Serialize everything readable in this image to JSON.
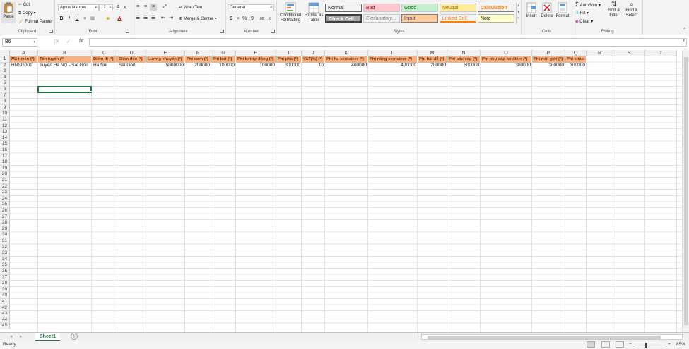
{
  "ribbon": {
    "clipboard": {
      "label": "Clipboard",
      "paste": "Paste",
      "cut": "Cut",
      "copy": "Copy",
      "format_painter": "Format Painter"
    },
    "font": {
      "label": "Font",
      "family": "Aptos Narrow",
      "size": "12"
    },
    "alignment": {
      "label": "Alignment",
      "wrap_text": "Wrap Text",
      "merge_center": "Merge & Center"
    },
    "number": {
      "label": "Number",
      "format": "General"
    },
    "styles": {
      "label": "Styles",
      "conditional": "Conditional Formatting",
      "format_table": "Format as Table",
      "cells": [
        {
          "text": "Normal",
          "bg": "#ffffff",
          "fg": "#000000"
        },
        {
          "text": "Bad",
          "bg": "#ffc7ce",
          "fg": "#9c0006"
        },
        {
          "text": "Good",
          "bg": "#c6efce",
          "fg": "#006100"
        },
        {
          "text": "Neutral",
          "bg": "#ffeb9c",
          "fg": "#9c5700"
        },
        {
          "text": "Calculation",
          "bg": "#f2f2f2",
          "fg": "#fa7d00"
        },
        {
          "text": "Check Cell",
          "bg": "#a5a5a5",
          "fg": "#ffffff"
        },
        {
          "text": "Explanatory...",
          "bg": "#ffffff",
          "fg": "#7f7f7f"
        },
        {
          "text": "Input",
          "bg": "#ffcc99",
          "fg": "#3f3f76"
        },
        {
          "text": "Linked Cell",
          "bg": "#ffffff",
          "fg": "#fa7d00"
        },
        {
          "text": "Note",
          "bg": "#ffffcc",
          "fg": "#000000"
        }
      ]
    },
    "cells": {
      "label": "Cells",
      "insert": "Insert",
      "delete": "Delete",
      "format": "Format"
    },
    "editing": {
      "label": "Editing",
      "autosum": "AutoSum",
      "fill": "Fill",
      "clear": "Clear",
      "sort_filter": "Sort & Filter",
      "find_select": "Find & Select"
    }
  },
  "formula_bar": {
    "name_box": "B6",
    "fx": "fx",
    "content": ""
  },
  "columns": [
    "A",
    "B",
    "C",
    "D",
    "E",
    "F",
    "G",
    "H",
    "I",
    "J",
    "K",
    "L",
    "M",
    "N",
    "O",
    "P",
    "Q",
    "R",
    "S",
    "T"
  ],
  "header_row": [
    "Mã tuyến (*)",
    "Tên tuyến (*)",
    "Điểm đi (*)",
    "Điểm đến (*)",
    "Lương chuyến (*)",
    "Phí cơm (*)",
    "Phí bot (*)",
    "Phí bot tự động (*)",
    "Phí phà (*)",
    "VAT(%) (*)",
    "Phí hạ container (*)",
    "Phí nâng container (*)",
    "Phí bãi đỗ (*)",
    "Phí bốc xếp (*)",
    "Phí phụ cấp bỏ điểm (*)",
    "Phí môi giới (*)",
    "Phí khác"
  ],
  "data_row": [
    "HNSG001",
    "Tuyến Hà Nội -  Sài Gòn",
    "Hà Nội",
    "Sài Gòn",
    "5000000",
    "200000",
    "100000",
    "100000",
    "300000",
    "10",
    "400000",
    "400000",
    "200000",
    "500000",
    "300000",
    "300000",
    "300000"
  ],
  "row_count": 45,
  "sheet_tab": "Sheet1",
  "status": {
    "ready": "Ready",
    "zoom": "85%"
  }
}
